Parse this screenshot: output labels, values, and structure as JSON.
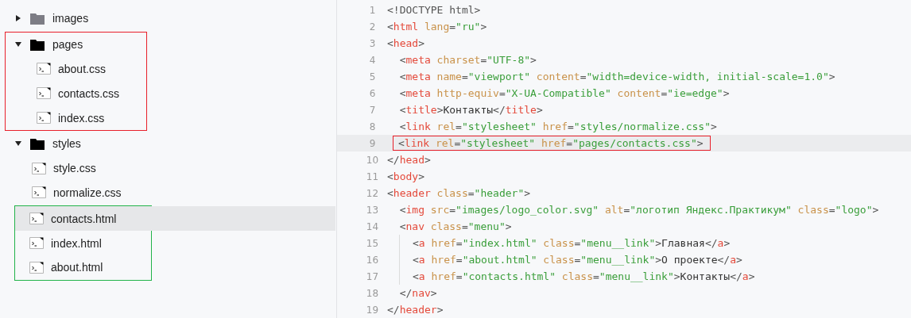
{
  "file_tree": [
    {
      "kind": "folder",
      "name": "images",
      "expanded": false
    },
    {
      "kind": "folder",
      "name": "pages",
      "expanded": true,
      "color": "#e8202a",
      "children": [
        {
          "kind": "file",
          "name": "about.css",
          "selected": false
        },
        {
          "kind": "file",
          "name": "contacts.css",
          "selected": false
        },
        {
          "kind": "file",
          "name": "index.css",
          "selected": false
        }
      ]
    },
    {
      "kind": "folder",
      "name": "styles",
      "expanded": true,
      "children": [
        {
          "kind": "file",
          "name": "style.css",
          "selected": false
        },
        {
          "kind": "file",
          "name": "normalize.css",
          "selected": false
        }
      ]
    },
    {
      "kind": "group",
      "color": "#22b34a",
      "children": [
        {
          "kind": "file",
          "name": "contacts.html",
          "selected": true
        },
        {
          "kind": "file",
          "name": "index.html",
          "selected": false
        },
        {
          "kind": "file",
          "name": "about.html",
          "selected": false
        }
      ]
    }
  ],
  "editor": {
    "lines": [
      {
        "number": "1",
        "selected": false,
        "guide": false,
        "tokens": [
          {
            "kind": "punct",
            "text": "<!DOCTYPE html>"
          }
        ]
      },
      {
        "number": "2",
        "selected": false,
        "guide": false,
        "tokens": [
          {
            "kind": "punct",
            "text": "<"
          },
          {
            "kind": "tag",
            "text": "html"
          },
          {
            "kind": "attr",
            "text": " lang"
          },
          {
            "kind": "punct",
            "text": "="
          },
          {
            "kind": "string",
            "text": "\"ru\""
          },
          {
            "kind": "punct",
            "text": ">"
          }
        ]
      },
      {
        "number": "3",
        "selected": false,
        "guide": false,
        "tokens": [
          {
            "kind": "punct",
            "text": "<"
          },
          {
            "kind": "tag",
            "text": "head"
          },
          {
            "kind": "punct",
            "text": ">"
          }
        ]
      },
      {
        "number": "4",
        "selected": false,
        "guide": false,
        "tokens": [
          {
            "kind": "punct",
            "text": "  <"
          },
          {
            "kind": "tag",
            "text": "meta"
          },
          {
            "kind": "attr",
            "text": " charset"
          },
          {
            "kind": "punct",
            "text": "="
          },
          {
            "kind": "string",
            "text": "\"UTF-8\""
          },
          {
            "kind": "punct",
            "text": ">"
          }
        ]
      },
      {
        "number": "5",
        "selected": false,
        "guide": false,
        "tokens": [
          {
            "kind": "punct",
            "text": "  <"
          },
          {
            "kind": "tag",
            "text": "meta"
          },
          {
            "kind": "attr",
            "text": " name"
          },
          {
            "kind": "punct",
            "text": "="
          },
          {
            "kind": "string",
            "text": "\"viewport\""
          },
          {
            "kind": "attr",
            "text": " content"
          },
          {
            "kind": "punct",
            "text": "="
          },
          {
            "kind": "string",
            "text": "\"width=device-width, initial-scale=1.0\""
          },
          {
            "kind": "punct",
            "text": ">"
          }
        ]
      },
      {
        "number": "6",
        "selected": false,
        "guide": false,
        "tokens": [
          {
            "kind": "punct",
            "text": "  <"
          },
          {
            "kind": "tag",
            "text": "meta"
          },
          {
            "kind": "attr",
            "text": " http-equiv"
          },
          {
            "kind": "punct",
            "text": "="
          },
          {
            "kind": "string",
            "text": "\"X-UA-Compatible\""
          },
          {
            "kind": "attr",
            "text": " content"
          },
          {
            "kind": "punct",
            "text": "="
          },
          {
            "kind": "string",
            "text": "\"ie=edge\""
          },
          {
            "kind": "punct",
            "text": ">"
          }
        ]
      },
      {
        "number": "7",
        "selected": false,
        "guide": false,
        "tokens": [
          {
            "kind": "punct",
            "text": "  <"
          },
          {
            "kind": "tag",
            "text": "title"
          },
          {
            "kind": "punct",
            "text": ">"
          },
          {
            "kind": "text",
            "text": "Контакты"
          },
          {
            "kind": "punct",
            "text": "</"
          },
          {
            "kind": "tag",
            "text": "title"
          },
          {
            "kind": "punct",
            "text": ">"
          }
        ]
      },
      {
        "number": "8",
        "selected": false,
        "guide": false,
        "tokens": [
          {
            "kind": "punct",
            "text": "  <"
          },
          {
            "kind": "tag",
            "text": "link"
          },
          {
            "kind": "attr",
            "text": " rel"
          },
          {
            "kind": "punct",
            "text": "="
          },
          {
            "kind": "string",
            "text": "\"stylesheet\""
          },
          {
            "kind": "attr",
            "text": " href"
          },
          {
            "kind": "punct",
            "text": "="
          },
          {
            "kind": "string",
            "text": "\"styles/normalize.css\""
          },
          {
            "kind": "punct",
            "text": ">"
          }
        ]
      },
      {
        "number": "9",
        "selected": true,
        "guide": false,
        "color": "#e8202a",
        "tokens": [
          {
            "kind": "punct",
            "text": "<"
          },
          {
            "kind": "tag",
            "text": "link"
          },
          {
            "kind": "attr",
            "text": " rel"
          },
          {
            "kind": "punct",
            "text": "="
          },
          {
            "kind": "string",
            "text": "\"stylesheet\""
          },
          {
            "kind": "attr",
            "text": " href"
          },
          {
            "kind": "punct",
            "text": "="
          },
          {
            "kind": "string",
            "text": "\"pages/contacts.css\""
          },
          {
            "kind": "punct",
            "text": ">"
          }
        ]
      },
      {
        "number": "10",
        "selected": false,
        "guide": false,
        "tokens": [
          {
            "kind": "punct",
            "text": "</"
          },
          {
            "kind": "tag",
            "text": "head"
          },
          {
            "kind": "punct",
            "text": ">"
          }
        ]
      },
      {
        "number": "11",
        "selected": false,
        "guide": false,
        "tokens": [
          {
            "kind": "punct",
            "text": "<"
          },
          {
            "kind": "tag",
            "text": "body"
          },
          {
            "kind": "punct",
            "text": ">"
          }
        ]
      },
      {
        "number": "12",
        "selected": false,
        "guide": false,
        "tokens": [
          {
            "kind": "punct",
            "text": "<"
          },
          {
            "kind": "tag",
            "text": "header"
          },
          {
            "kind": "attr",
            "text": " class"
          },
          {
            "kind": "punct",
            "text": "="
          },
          {
            "kind": "string",
            "text": "\"header\""
          },
          {
            "kind": "punct",
            "text": ">"
          }
        ]
      },
      {
        "number": "13",
        "selected": false,
        "guide": false,
        "tokens": [
          {
            "kind": "punct",
            "text": "  <"
          },
          {
            "kind": "tag",
            "text": "img"
          },
          {
            "kind": "attr",
            "text": " src"
          },
          {
            "kind": "punct",
            "text": "="
          },
          {
            "kind": "string",
            "text": "\"images/logo_color.svg\""
          },
          {
            "kind": "attr",
            "text": " alt"
          },
          {
            "kind": "punct",
            "text": "="
          },
          {
            "kind": "string",
            "text": "\"логотип Яндекс.Практикум\""
          },
          {
            "kind": "attr",
            "text": " class"
          },
          {
            "kind": "punct",
            "text": "="
          },
          {
            "kind": "string",
            "text": "\"logo\""
          },
          {
            "kind": "punct",
            "text": ">"
          }
        ]
      },
      {
        "number": "14",
        "selected": false,
        "guide": false,
        "tokens": [
          {
            "kind": "punct",
            "text": "  <"
          },
          {
            "kind": "tag",
            "text": "nav"
          },
          {
            "kind": "attr",
            "text": " class"
          },
          {
            "kind": "punct",
            "text": "="
          },
          {
            "kind": "string",
            "text": "\"menu\""
          },
          {
            "kind": "punct",
            "text": ">"
          }
        ]
      },
      {
        "number": "15",
        "selected": false,
        "guide": true,
        "tokens": [
          {
            "kind": "punct",
            "text": "<"
          },
          {
            "kind": "tag",
            "text": "a"
          },
          {
            "kind": "attr",
            "text": " href"
          },
          {
            "kind": "punct",
            "text": "="
          },
          {
            "kind": "string",
            "text": "\"index.html\""
          },
          {
            "kind": "attr",
            "text": " class"
          },
          {
            "kind": "punct",
            "text": "="
          },
          {
            "kind": "string",
            "text": "\"menu__link\""
          },
          {
            "kind": "punct",
            "text": ">"
          },
          {
            "kind": "text",
            "text": "Главная"
          },
          {
            "kind": "punct",
            "text": "</"
          },
          {
            "kind": "tag",
            "text": "a"
          },
          {
            "kind": "punct",
            "text": ">"
          }
        ]
      },
      {
        "number": "16",
        "selected": false,
        "guide": true,
        "tokens": [
          {
            "kind": "punct",
            "text": "<"
          },
          {
            "kind": "tag",
            "text": "a"
          },
          {
            "kind": "attr",
            "text": " href"
          },
          {
            "kind": "punct",
            "text": "="
          },
          {
            "kind": "string",
            "text": "\"about.html\""
          },
          {
            "kind": "attr",
            "text": " class"
          },
          {
            "kind": "punct",
            "text": "="
          },
          {
            "kind": "string",
            "text": "\"menu__link\""
          },
          {
            "kind": "punct",
            "text": ">"
          },
          {
            "kind": "text",
            "text": "О проекте"
          },
          {
            "kind": "punct",
            "text": "</"
          },
          {
            "kind": "tag",
            "text": "a"
          },
          {
            "kind": "punct",
            "text": ">"
          }
        ]
      },
      {
        "number": "17",
        "selected": false,
        "guide": true,
        "tokens": [
          {
            "kind": "punct",
            "text": "<"
          },
          {
            "kind": "tag",
            "text": "a"
          },
          {
            "kind": "attr",
            "text": " href"
          },
          {
            "kind": "punct",
            "text": "="
          },
          {
            "kind": "string",
            "text": "\"contacts.html\""
          },
          {
            "kind": "attr",
            "text": " class"
          },
          {
            "kind": "punct",
            "text": "="
          },
          {
            "kind": "string",
            "text": "\"menu__link\""
          },
          {
            "kind": "punct",
            "text": ">"
          },
          {
            "kind": "text",
            "text": "Контакты"
          },
          {
            "kind": "punct",
            "text": "</"
          },
          {
            "kind": "tag",
            "text": "a"
          },
          {
            "kind": "punct",
            "text": ">"
          }
        ]
      },
      {
        "number": "18",
        "selected": false,
        "guide": false,
        "tokens": [
          {
            "kind": "punct",
            "text": "  </"
          },
          {
            "kind": "tag",
            "text": "nav"
          },
          {
            "kind": "punct",
            "text": ">"
          }
        ]
      },
      {
        "number": "19",
        "selected": false,
        "guide": false,
        "tokens": [
          {
            "kind": "punct",
            "text": "</"
          },
          {
            "kind": "tag",
            "text": "header"
          },
          {
            "kind": "punct",
            "text": ">"
          }
        ]
      }
    ]
  }
}
